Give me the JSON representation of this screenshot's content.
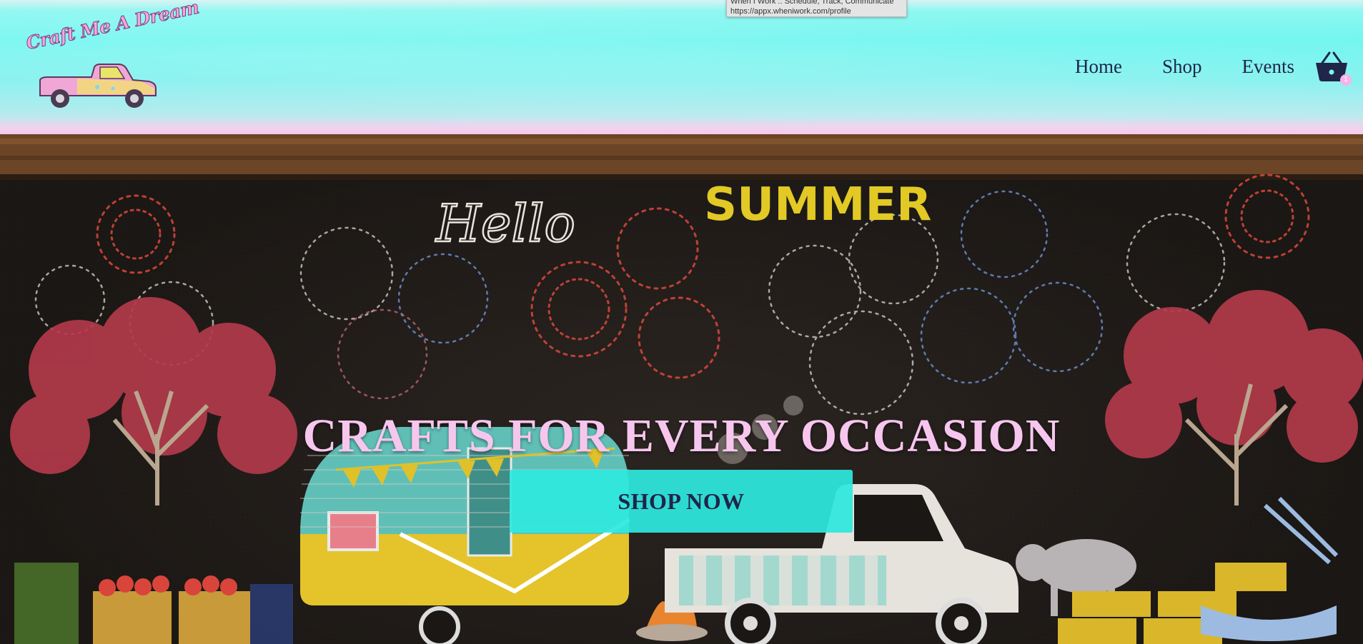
{
  "site": {
    "logo_text": "Craft Me A Dream"
  },
  "nav": {
    "items": [
      {
        "label": "Home"
      },
      {
        "label": "Shop"
      },
      {
        "label": "Events"
      }
    ]
  },
  "cart": {
    "icon": "basket-icon",
    "count": "1"
  },
  "tooltip": {
    "title": "When I Work :: Schedule, Track, Communicate",
    "url": "https://appx.wheniwork.com/profile"
  },
  "hero": {
    "title": "CRAFTS FOR EVERY OCCASION",
    "button_label": "SHOP NOW",
    "chalk_hello": "Hello",
    "chalk_summer": "SUMMER"
  },
  "colors": {
    "header_bg": "#6ff6ef",
    "nav_text": "#20254a",
    "hero_title": "#f7c6ee",
    "button_bg": "#2ee8de",
    "cart_badge": "#f7b3e8"
  }
}
